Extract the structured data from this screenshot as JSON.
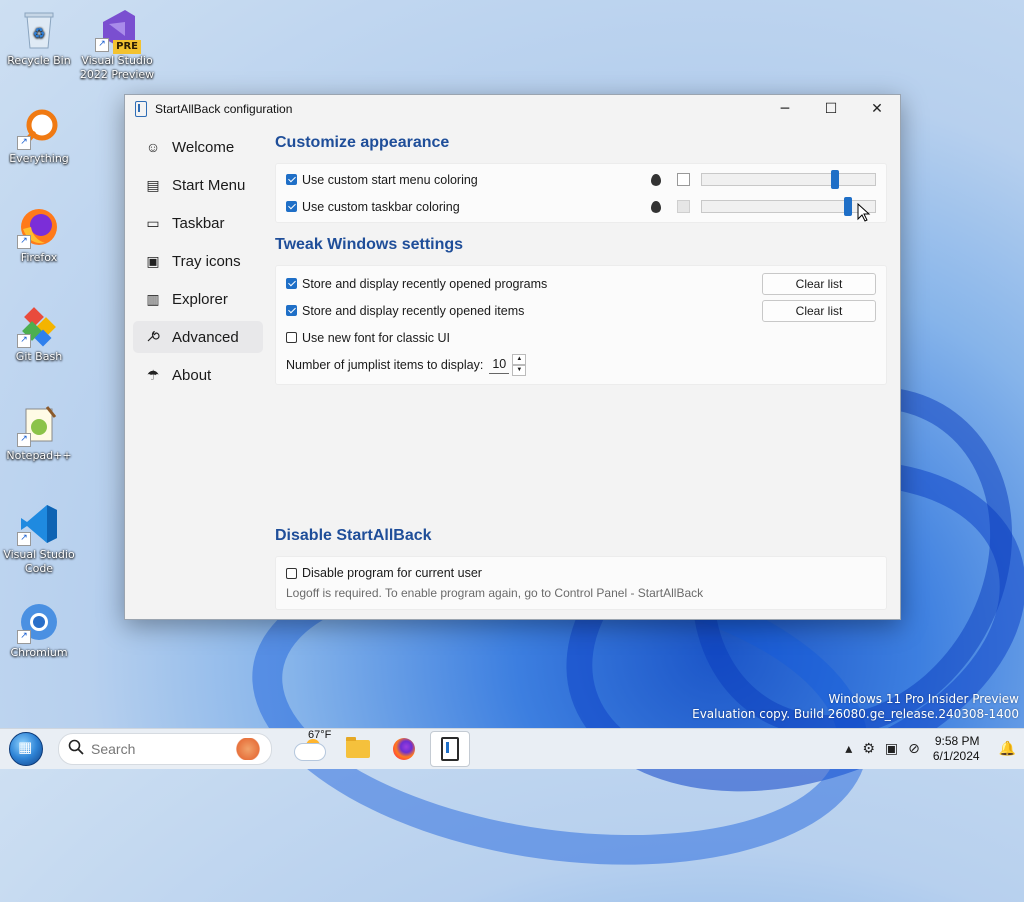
{
  "desktop": {
    "icons": [
      {
        "label_lines": [
          "Recycle Bin"
        ],
        "icon": "recycle-bin-icon"
      },
      {
        "label_lines": [
          "Visual Studio",
          "2022 Preview"
        ],
        "icon": "visual-studio-icon",
        "badge": "PRE"
      },
      {
        "label_lines": [
          "Everything"
        ],
        "icon": "everything-search-icon"
      },
      {
        "label_lines": [
          "Firefox"
        ],
        "icon": "firefox-icon"
      },
      {
        "label_lines": [
          "Git Bash"
        ],
        "icon": "git-bash-icon"
      },
      {
        "label_lines": [
          "Notepad++"
        ],
        "icon": "notepad-plus-plus-icon"
      },
      {
        "label_lines": [
          "Visual Studio",
          "Code"
        ],
        "icon": "vscode-icon"
      },
      {
        "label_lines": [
          "Chromium"
        ],
        "icon": "chromium-icon"
      }
    ],
    "watermark": {
      "line1": "Windows 11 Pro Insider Preview",
      "line2": "Evaluation copy. Build 26080.ge_release.240308-1400"
    }
  },
  "window": {
    "title": "StartAllBack configuration",
    "controls": {
      "minimize": "─",
      "maximize": "☐",
      "close": "✕"
    },
    "sidebar": {
      "items": [
        {
          "label": "Welcome",
          "icon": "☺"
        },
        {
          "label": "Start Menu",
          "icon": "▤"
        },
        {
          "label": "Taskbar",
          "icon": "▭"
        },
        {
          "label": "Tray icons",
          "icon": "▣"
        },
        {
          "label": "Explorer",
          "icon": "▥"
        },
        {
          "label": "Advanced",
          "icon": "🔧"
        },
        {
          "label": "About",
          "icon": "☂"
        }
      ],
      "active": "Advanced"
    },
    "sections": {
      "appearance": {
        "title": "Customize appearance",
        "start_menu_coloring": {
          "label": "Use custom start menu coloring",
          "checked": true,
          "slider_fraction": 0.78
        },
        "taskbar_coloring": {
          "label": "Use custom taskbar coloring",
          "checked": true,
          "slider_fraction": 0.86
        }
      },
      "tweak": {
        "title": "Tweak Windows settings",
        "recent_programs": {
          "label": "Store and display recently opened programs",
          "checked": true,
          "button": "Clear list"
        },
        "recent_items": {
          "label": "Store and display recently opened items",
          "checked": true,
          "button": "Clear list"
        },
        "new_font": {
          "label": "Use new font for classic UI",
          "checked": false
        },
        "jumplist": {
          "label": "Number of jumplist items to display:",
          "value": "10"
        }
      },
      "disable": {
        "title": "Disable StartAllBack",
        "disable_user": {
          "label": "Disable program for current user",
          "checked": false
        },
        "note": "Logoff is required. To enable program again, go to Control Panel - StartAllBack"
      }
    }
  },
  "taskbar": {
    "search_placeholder": "Search",
    "weather_temp": "67°F",
    "clock_time": "9:58 PM",
    "clock_date": "6/1/2024"
  }
}
